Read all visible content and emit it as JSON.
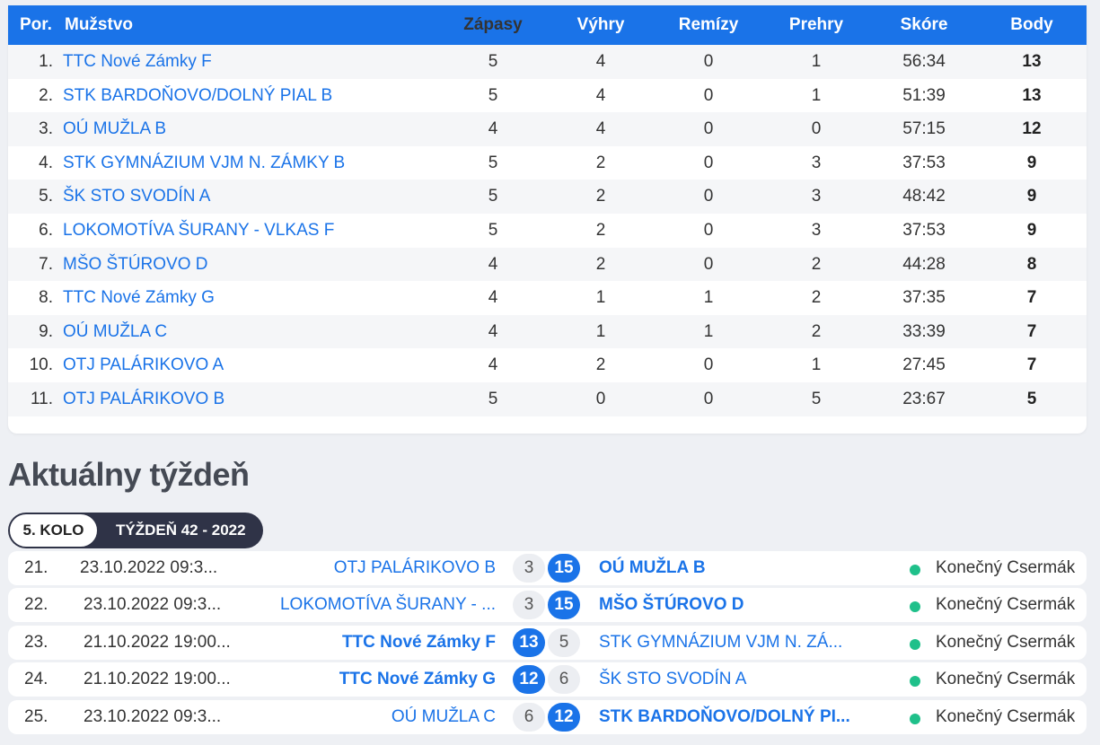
{
  "standings": {
    "headers": {
      "pos": "Por.",
      "team": "Mužstvo",
      "played": "Zápasy",
      "wins": "Výhry",
      "draws": "Remízy",
      "losses": "Prehry",
      "score": "Skóre",
      "points": "Body"
    },
    "rows": [
      {
        "pos": "1.",
        "team": "TTC Nové Zámky F",
        "played": "5",
        "wins": "4",
        "draws": "0",
        "losses": "1",
        "score": "56:34",
        "points": "13"
      },
      {
        "pos": "2.",
        "team": "STK BARDOŇOVO/DOLNÝ PIAL B",
        "played": "5",
        "wins": "4",
        "draws": "0",
        "losses": "1",
        "score": "51:39",
        "points": "13"
      },
      {
        "pos": "3.",
        "team": "OÚ MUŽLA B",
        "played": "4",
        "wins": "4",
        "draws": "0",
        "losses": "0",
        "score": "57:15",
        "points": "12"
      },
      {
        "pos": "4.",
        "team": "STK GYMNÁZIUM VJM N. ZÁMKY B",
        "played": "5",
        "wins": "2",
        "draws": "0",
        "losses": "3",
        "score": "37:53",
        "points": "9"
      },
      {
        "pos": "5.",
        "team": "ŠK STO SVODÍN A",
        "played": "5",
        "wins": "2",
        "draws": "0",
        "losses": "3",
        "score": "48:42",
        "points": "9"
      },
      {
        "pos": "6.",
        "team": "LOKOMOTÍVA ŠURANY - VLKAS F",
        "played": "5",
        "wins": "2",
        "draws": "0",
        "losses": "3",
        "score": "37:53",
        "points": "9"
      },
      {
        "pos": "7.",
        "team": "MŠO ŠTÚROVO D",
        "played": "4",
        "wins": "2",
        "draws": "0",
        "losses": "2",
        "score": "44:28",
        "points": "8"
      },
      {
        "pos": "8.",
        "team": "TTC Nové Zámky G",
        "played": "4",
        "wins": "1",
        "draws": "1",
        "losses": "2",
        "score": "37:35",
        "points": "7"
      },
      {
        "pos": "9.",
        "team": "OÚ MUŽLA C",
        "played": "4",
        "wins": "1",
        "draws": "1",
        "losses": "2",
        "score": "33:39",
        "points": "7"
      },
      {
        "pos": "10.",
        "team": "OTJ PALÁRIKOVO A",
        "played": "4",
        "wins": "2",
        "draws": "0",
        "losses": "1",
        "score": "27:45",
        "points": "7"
      },
      {
        "pos": "11.",
        "team": "OTJ PALÁRIKOVO B",
        "played": "5",
        "wins": "0",
        "draws": "0",
        "losses": "5",
        "score": "23:67",
        "points": "5"
      }
    ]
  },
  "current_week": {
    "title": "Aktuálny týždeň",
    "round_label": "5. KOLO",
    "week_label": "TÝŽDEŇ 42 - 2022",
    "matches": [
      {
        "no": "21.",
        "date": "23.10.2022 09:3...",
        "home": "OTJ PALÁRIKOVO B",
        "home_score": "3",
        "away_score": "15",
        "away": "OÚ MUŽLA B",
        "winner": "away",
        "status": "Konečný Csermák"
      },
      {
        "no": "22.",
        "date": "23.10.2022 09:3...",
        "home": "LOKOMOTÍVA ŠURANY - ...",
        "home_score": "3",
        "away_score": "15",
        "away": "MŠO ŠTÚROVO D",
        "winner": "away",
        "status": "Konečný Csermák"
      },
      {
        "no": "23.",
        "date": "21.10.2022 19:00...",
        "home": "TTC Nové Zámky F",
        "home_score": "13",
        "away_score": "5",
        "away": "STK GYMNÁZIUM VJM N. ZÁ...",
        "winner": "home",
        "status": "Konečný Csermák"
      },
      {
        "no": "24.",
        "date": "21.10.2022 19:00...",
        "home": "TTC Nové Zámky G",
        "home_score": "12",
        "away_score": "6",
        "away": "ŠK STO SVODÍN A",
        "winner": "home",
        "status": "Konečný Csermák"
      },
      {
        "no": "25.",
        "date": "23.10.2022 09:3...",
        "home": "OÚ MUŽLA C",
        "home_score": "6",
        "away_score": "12",
        "away": "STK BARDOŇOVO/DOLNÝ PI...",
        "winner": "away",
        "status": "Konečný Csermák"
      }
    ],
    "status_color": "#1fc08a"
  },
  "colors": {
    "accent": "#1a73e8",
    "pill_dark": "#2f3347",
    "background": "#eef0f4"
  }
}
